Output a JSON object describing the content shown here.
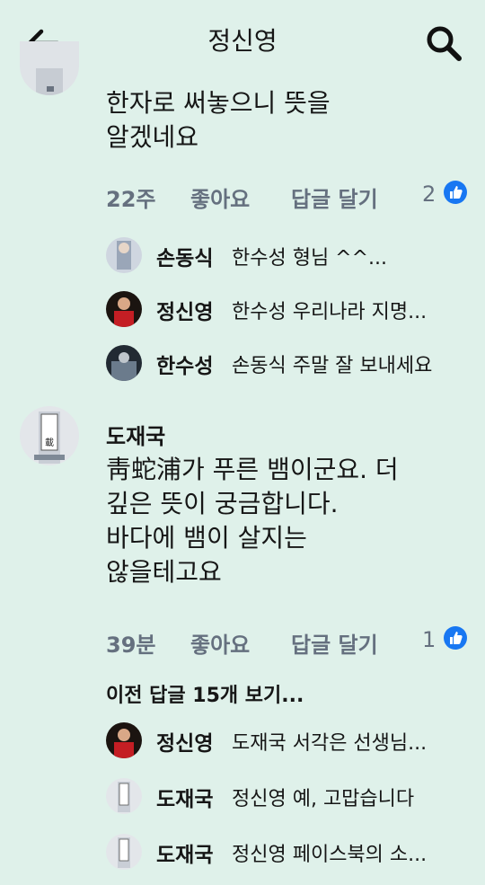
{
  "header": {
    "title": "정신영",
    "back_icon": "back-arrow-icon",
    "search_icon": "search-icon"
  },
  "comment1": {
    "text_line1": "한자로 써놓으니 뜻을",
    "text_line2": "알겠네요",
    "time": "22주",
    "like_label": "좋아요",
    "reply_label": "답글 달기",
    "likes": "2"
  },
  "replies1": [
    {
      "name": "손동식",
      "text": "한수성 형님 ^^..."
    },
    {
      "name": "정신영",
      "text": "한수성 우리나라 지명..."
    },
    {
      "name": "한수성",
      "text": "손동식 주말 잘 보내세요"
    }
  ],
  "comment2": {
    "author": "도재국",
    "text_line1": "靑蛇浦가 푸른 뱀이군요. 더",
    "text_line2": "깊은 뜻이 궁금합니다.",
    "text_line3": "바다에 뱀이 살지는",
    "text_line4": "않을테고요",
    "time": "39분",
    "like_label": "좋아요",
    "reply_label": "답글 달기",
    "likes": "1",
    "avatar_text": "載嶽山"
  },
  "previous_replies": "이전 답글 15개 보기...",
  "replies2": [
    {
      "name": "정신영",
      "text": "도재국 서각은 선생님..."
    },
    {
      "name": "도재국",
      "text": "정신영 예, 고맙습니다"
    },
    {
      "name": "도재국",
      "text": "정신영 페이스북의 소..."
    }
  ],
  "colors": {
    "background": "#dff1ea",
    "meta_text": "#65707f",
    "like_blue": "#1877f2"
  }
}
